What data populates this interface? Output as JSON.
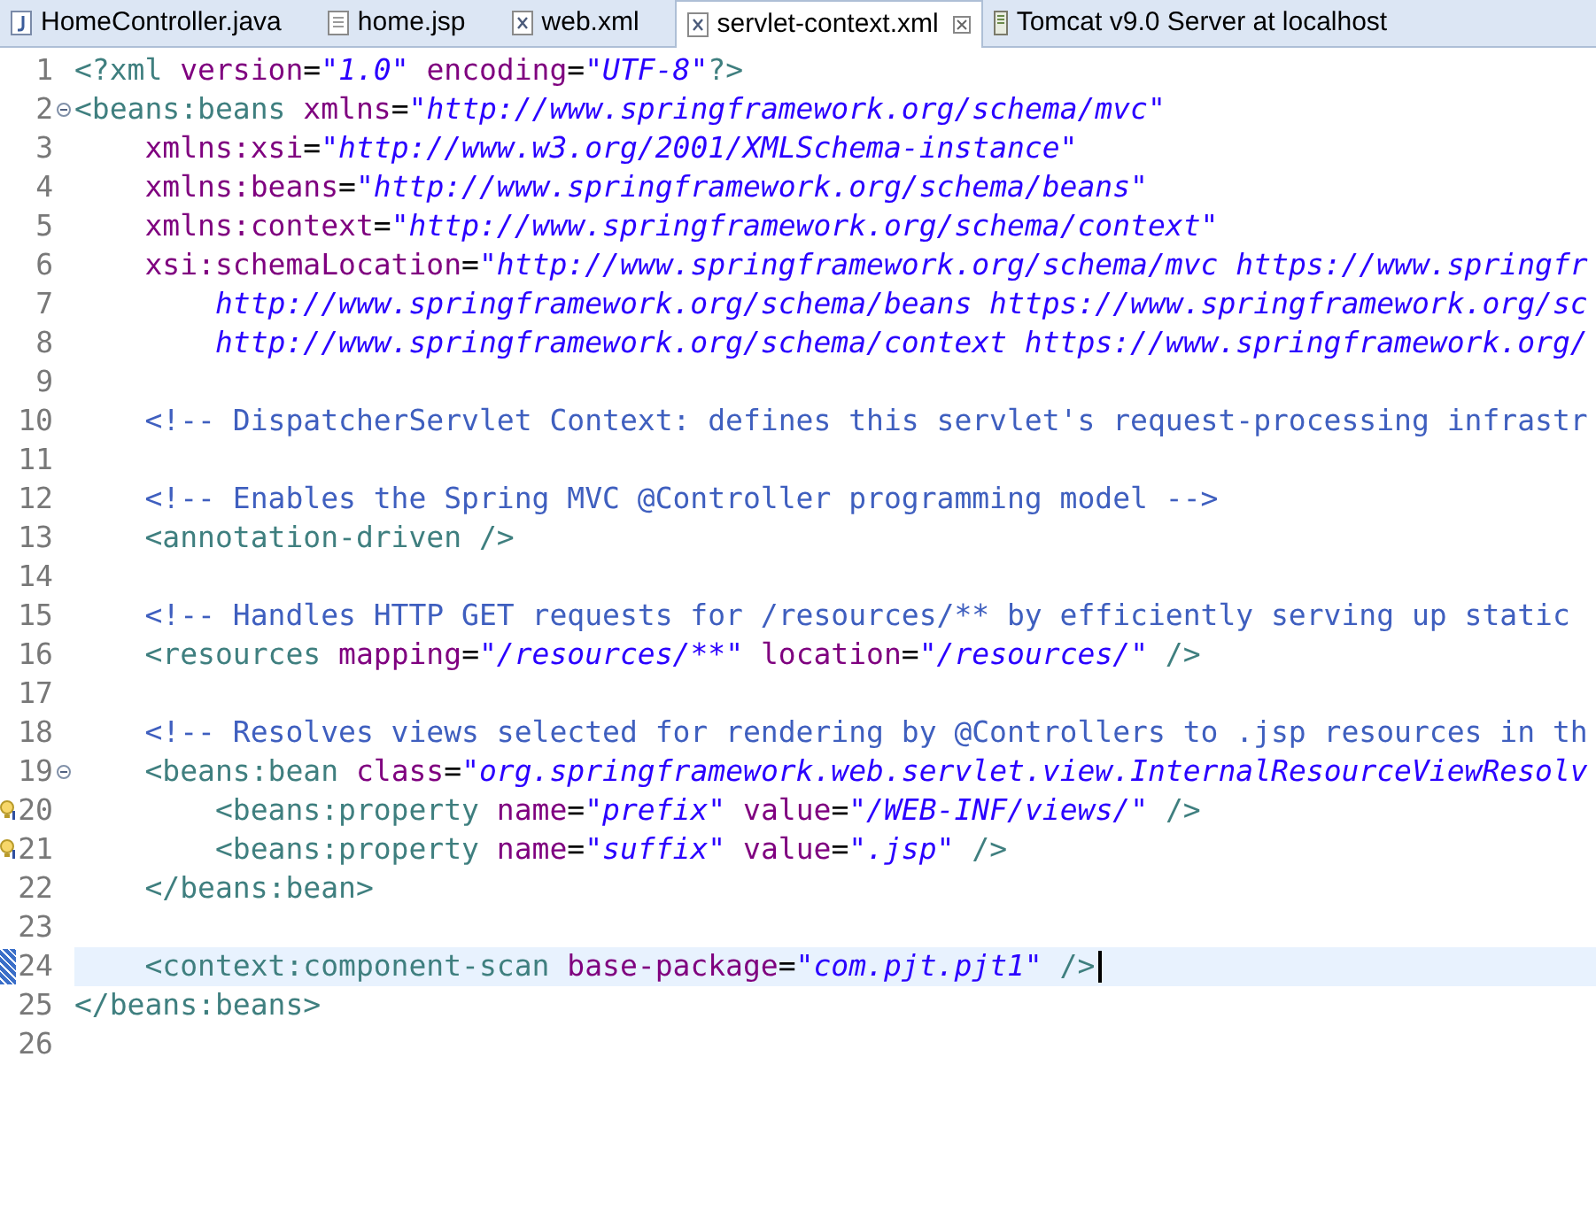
{
  "tabs": [
    {
      "label": "HomeController.java",
      "kind": "java",
      "selected": false
    },
    {
      "label": "home.jsp",
      "kind": "jsp",
      "selected": false
    },
    {
      "label": "web.xml",
      "kind": "xml",
      "selected": false
    },
    {
      "label": "servlet-context.xml",
      "kind": "xml",
      "selected": true
    },
    {
      "label": "Tomcat v9.0 Server at localhost",
      "kind": "server",
      "selected": false
    }
  ],
  "lines": [
    {
      "number": "1",
      "fold": false,
      "hint": false,
      "changed": false,
      "current": false,
      "tokens": [
        {
          "kind": "tag",
          "text": "<?xml"
        },
        {
          "kind": "attr",
          "text": " version"
        },
        {
          "kind": "plain",
          "text": "="
        },
        {
          "kind": "value",
          "text": "\"1.0\""
        },
        {
          "kind": "attr",
          "text": " encoding"
        },
        {
          "kind": "plain",
          "text": "="
        },
        {
          "kind": "value",
          "text": "\"UTF-8\""
        },
        {
          "kind": "tag",
          "text": "?>"
        }
      ]
    },
    {
      "number": "2",
      "fold": true,
      "hint": false,
      "changed": false,
      "current": false,
      "tokens": [
        {
          "kind": "tag",
          "text": "<beans:beans"
        },
        {
          "kind": "attr",
          "text": " xmlns"
        },
        {
          "kind": "plain",
          "text": "="
        },
        {
          "kind": "value",
          "text": "\"http://www.springframework.org/schema/mvc\""
        }
      ]
    },
    {
      "number": "3",
      "fold": false,
      "hint": false,
      "changed": false,
      "current": false,
      "tokens": [
        {
          "kind": "attr",
          "text": "    xmlns:xsi"
        },
        {
          "kind": "plain",
          "text": "="
        },
        {
          "kind": "value",
          "text": "\"http://www.w3.org/2001/XMLSchema-instance\""
        }
      ]
    },
    {
      "number": "4",
      "fold": false,
      "hint": false,
      "changed": false,
      "current": false,
      "tokens": [
        {
          "kind": "attr",
          "text": "    xmlns:beans"
        },
        {
          "kind": "plain",
          "text": "="
        },
        {
          "kind": "value",
          "text": "\"http://www.springframework.org/schema/beans\""
        }
      ]
    },
    {
      "number": "5",
      "fold": false,
      "hint": false,
      "changed": false,
      "current": false,
      "tokens": [
        {
          "kind": "attr",
          "text": "    xmlns:context"
        },
        {
          "kind": "plain",
          "text": "="
        },
        {
          "kind": "value",
          "text": "\"http://www.springframework.org/schema/context\""
        }
      ]
    },
    {
      "number": "6",
      "fold": false,
      "hint": false,
      "changed": false,
      "current": false,
      "tokens": [
        {
          "kind": "attr",
          "text": "    xsi:schemaLocation"
        },
        {
          "kind": "plain",
          "text": "="
        },
        {
          "kind": "value",
          "text": "\"http://www.springframework.org/schema/mvc https://www.springfr"
        }
      ]
    },
    {
      "number": "7",
      "fold": false,
      "hint": false,
      "changed": false,
      "current": false,
      "tokens": [
        {
          "kind": "value",
          "text": "        http://www.springframework.org/schema/beans https://www.springframework.org/sc"
        }
      ]
    },
    {
      "number": "8",
      "fold": false,
      "hint": false,
      "changed": false,
      "current": false,
      "tokens": [
        {
          "kind": "value",
          "text": "        http://www.springframework.org/schema/context https://www.springframework.org/"
        }
      ]
    },
    {
      "number": "9",
      "fold": false,
      "hint": false,
      "changed": false,
      "current": false
    },
    {
      "number": "10",
      "fold": false,
      "hint": false,
      "changed": false,
      "current": false,
      "tokens": [
        {
          "kind": "comment",
          "text": "    <!-- DispatcherServlet Context: defines this servlet's request-processing infrastr"
        }
      ]
    },
    {
      "number": "11",
      "fold": false,
      "hint": false,
      "changed": false,
      "current": false
    },
    {
      "number": "12",
      "fold": false,
      "hint": false,
      "changed": false,
      "current": false,
      "tokens": [
        {
          "kind": "comment",
          "text": "    <!-- Enables the Spring MVC @Controller programming model -->"
        }
      ]
    },
    {
      "number": "13",
      "fold": false,
      "hint": false,
      "changed": false,
      "current": false,
      "tokens": [
        {
          "kind": "tag",
          "text": "    <annotation-driven />"
        }
      ]
    },
    {
      "number": "14",
      "fold": false,
      "hint": false,
      "changed": false,
      "current": false
    },
    {
      "number": "15",
      "fold": false,
      "hint": false,
      "changed": false,
      "current": false,
      "tokens": [
        {
          "kind": "comment",
          "text": "    <!-- Handles HTTP GET requests for /resources/** by efficiently serving up static"
        }
      ]
    },
    {
      "number": "16",
      "fold": false,
      "hint": false,
      "changed": false,
      "current": false,
      "tokens": [
        {
          "kind": "tag",
          "text": "    <resources"
        },
        {
          "kind": "attr",
          "text": " mapping"
        },
        {
          "kind": "plain",
          "text": "="
        },
        {
          "kind": "value",
          "text": "\"/resources/**\""
        },
        {
          "kind": "attr",
          "text": " location"
        },
        {
          "kind": "plain",
          "text": "="
        },
        {
          "kind": "value",
          "text": "\"/resources/\""
        },
        {
          "kind": "tag",
          "text": " />"
        }
      ]
    },
    {
      "number": "17",
      "fold": false,
      "hint": false,
      "changed": false,
      "current": false
    },
    {
      "number": "18",
      "fold": false,
      "hint": false,
      "changed": false,
      "current": false,
      "tokens": [
        {
          "kind": "comment",
          "text": "    <!-- Resolves views selected for rendering by @Controllers to .jsp resources in th"
        }
      ]
    },
    {
      "number": "19",
      "fold": true,
      "hint": false,
      "changed": false,
      "current": false,
      "tokens": [
        {
          "kind": "tag",
          "text": "    <beans:bean"
        },
        {
          "kind": "attr",
          "text": " class"
        },
        {
          "kind": "plain",
          "text": "="
        },
        {
          "kind": "value",
          "text": "\"org.springframework.web.servlet.view.InternalResourceViewResolv"
        }
      ]
    },
    {
      "number": "20",
      "fold": false,
      "hint": true,
      "changed": false,
      "current": false,
      "tokens": [
        {
          "kind": "tag",
          "text": "        <beans:property"
        },
        {
          "kind": "attr",
          "text": " name"
        },
        {
          "kind": "plain",
          "text": "="
        },
        {
          "kind": "value",
          "text": "\"prefix\""
        },
        {
          "kind": "attr",
          "text": " value"
        },
        {
          "kind": "plain",
          "text": "="
        },
        {
          "kind": "value",
          "text": "\"/WEB-INF/views/\""
        },
        {
          "kind": "tag",
          "text": " />"
        }
      ]
    },
    {
      "number": "21",
      "fold": false,
      "hint": true,
      "changed": false,
      "current": false,
      "tokens": [
        {
          "kind": "tag",
          "text": "        <beans:property"
        },
        {
          "kind": "attr",
          "text": " name"
        },
        {
          "kind": "plain",
          "text": "="
        },
        {
          "kind": "value",
          "text": "\"suffix\""
        },
        {
          "kind": "attr",
          "text": " value"
        },
        {
          "kind": "plain",
          "text": "="
        },
        {
          "kind": "value",
          "text": "\".jsp\""
        },
        {
          "kind": "tag",
          "text": " />"
        }
      ]
    },
    {
      "number": "22",
      "fold": false,
      "hint": false,
      "changed": false,
      "current": false,
      "tokens": [
        {
          "kind": "tag",
          "text": "    </beans:bean>"
        }
      ]
    },
    {
      "number": "23",
      "fold": false,
      "hint": false,
      "changed": false,
      "current": false
    },
    {
      "number": "24",
      "fold": false,
      "hint": false,
      "changed": true,
      "current": true,
      "tokens": [
        {
          "kind": "tag",
          "text": "    <context:component-scan"
        },
        {
          "kind": "attr",
          "text": " base-package"
        },
        {
          "kind": "plain",
          "text": "="
        },
        {
          "kind": "value",
          "text": "\"com.pjt.pjt1\""
        },
        {
          "kind": "tag",
          "text": " />"
        }
      ]
    },
    {
      "number": "25",
      "fold": false,
      "hint": false,
      "changed": false,
      "current": false,
      "tokens": [
        {
          "kind": "tag",
          "text": "</beans:beans>"
        }
      ]
    },
    {
      "number": "26",
      "fold": false,
      "hint": false,
      "changed": false,
      "current": false
    }
  ]
}
